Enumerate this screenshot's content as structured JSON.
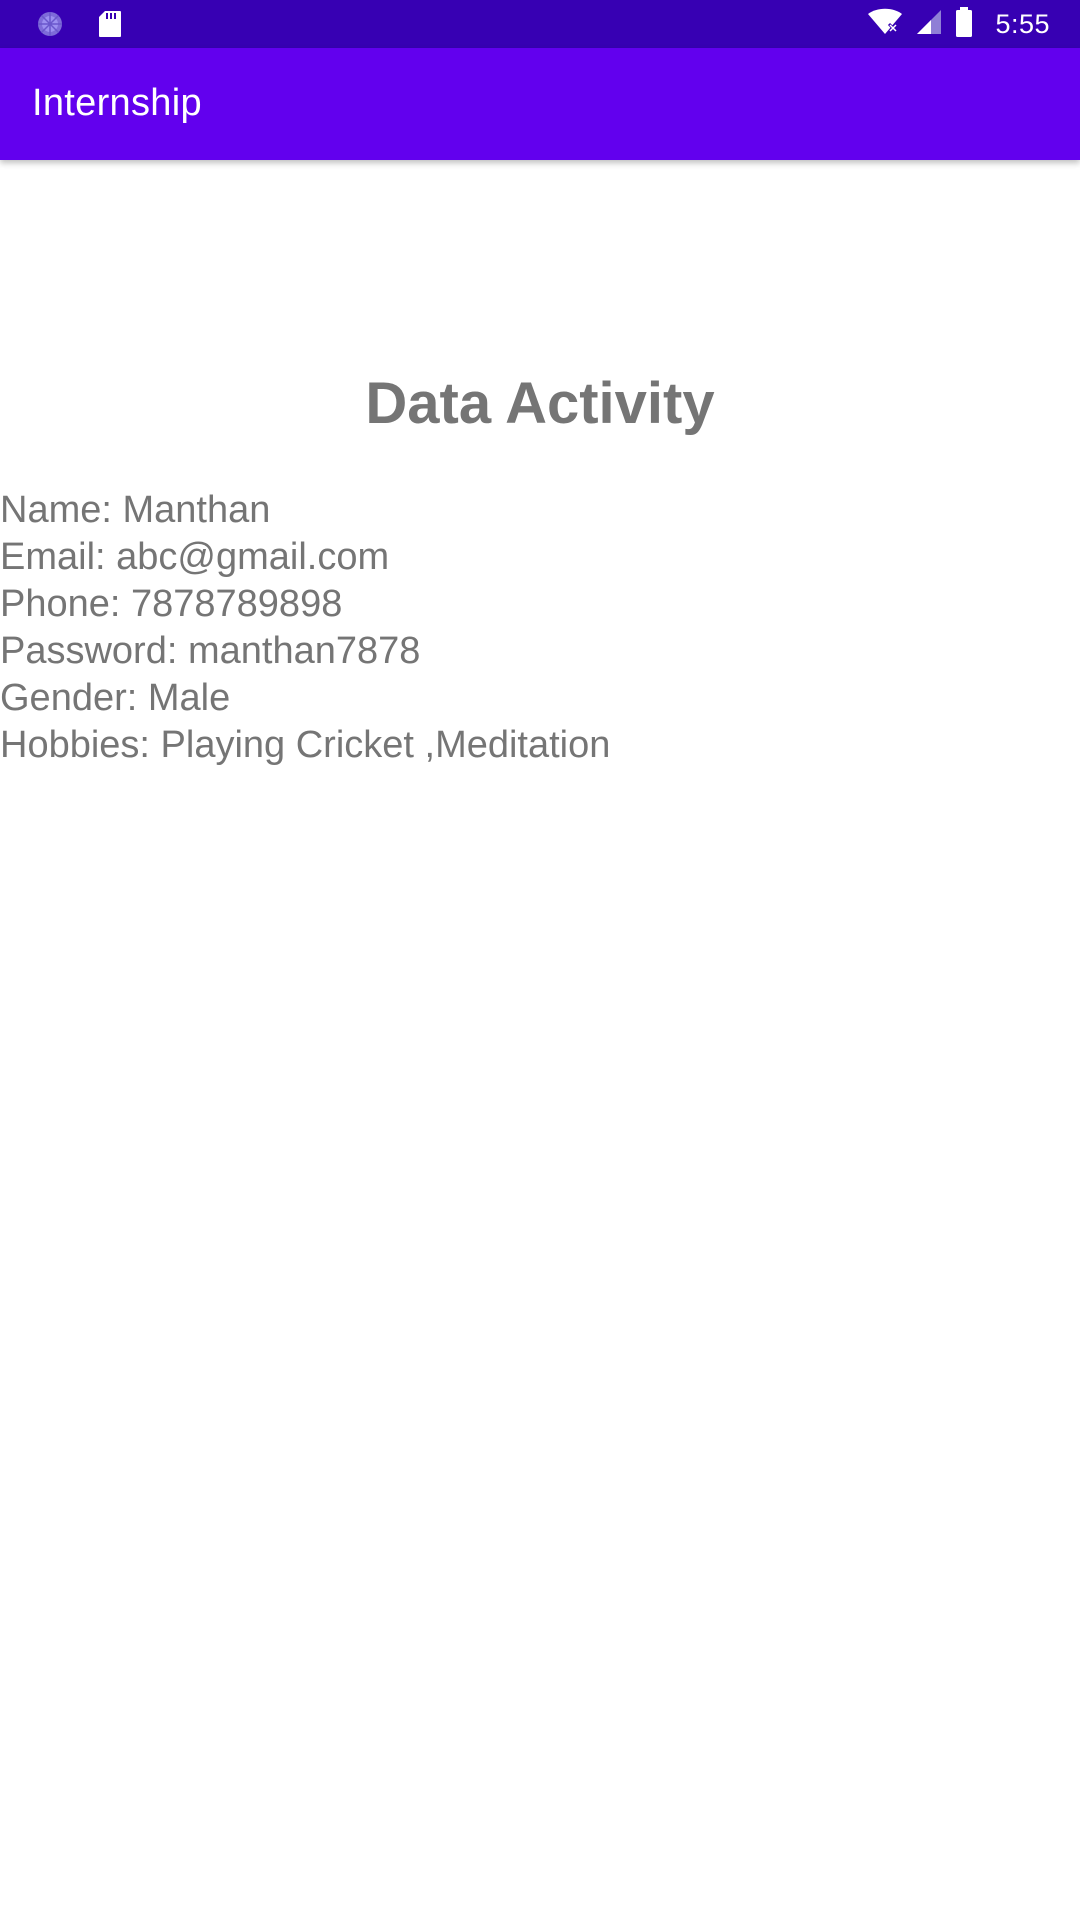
{
  "status_bar": {
    "time": "5:55",
    "icons": [
      "sync-icon",
      "sd-card-icon",
      "wifi-off-icon",
      "signal-icon",
      "battery-icon"
    ],
    "colors": {
      "background": "#3700b3"
    }
  },
  "app_bar": {
    "title": "Internship",
    "colors": {
      "background": "#6200ee",
      "text": "#ffffff"
    }
  },
  "main": {
    "heading": "Data Activity",
    "details": [
      "Name: Manthan",
      "Email: abc@gmail.com",
      "Phone: 7878789898",
      "Password: manthan7878",
      "Gender: Male",
      "Hobbies: Playing Cricket ,Meditation"
    ],
    "colors": {
      "text": "#757575"
    }
  }
}
